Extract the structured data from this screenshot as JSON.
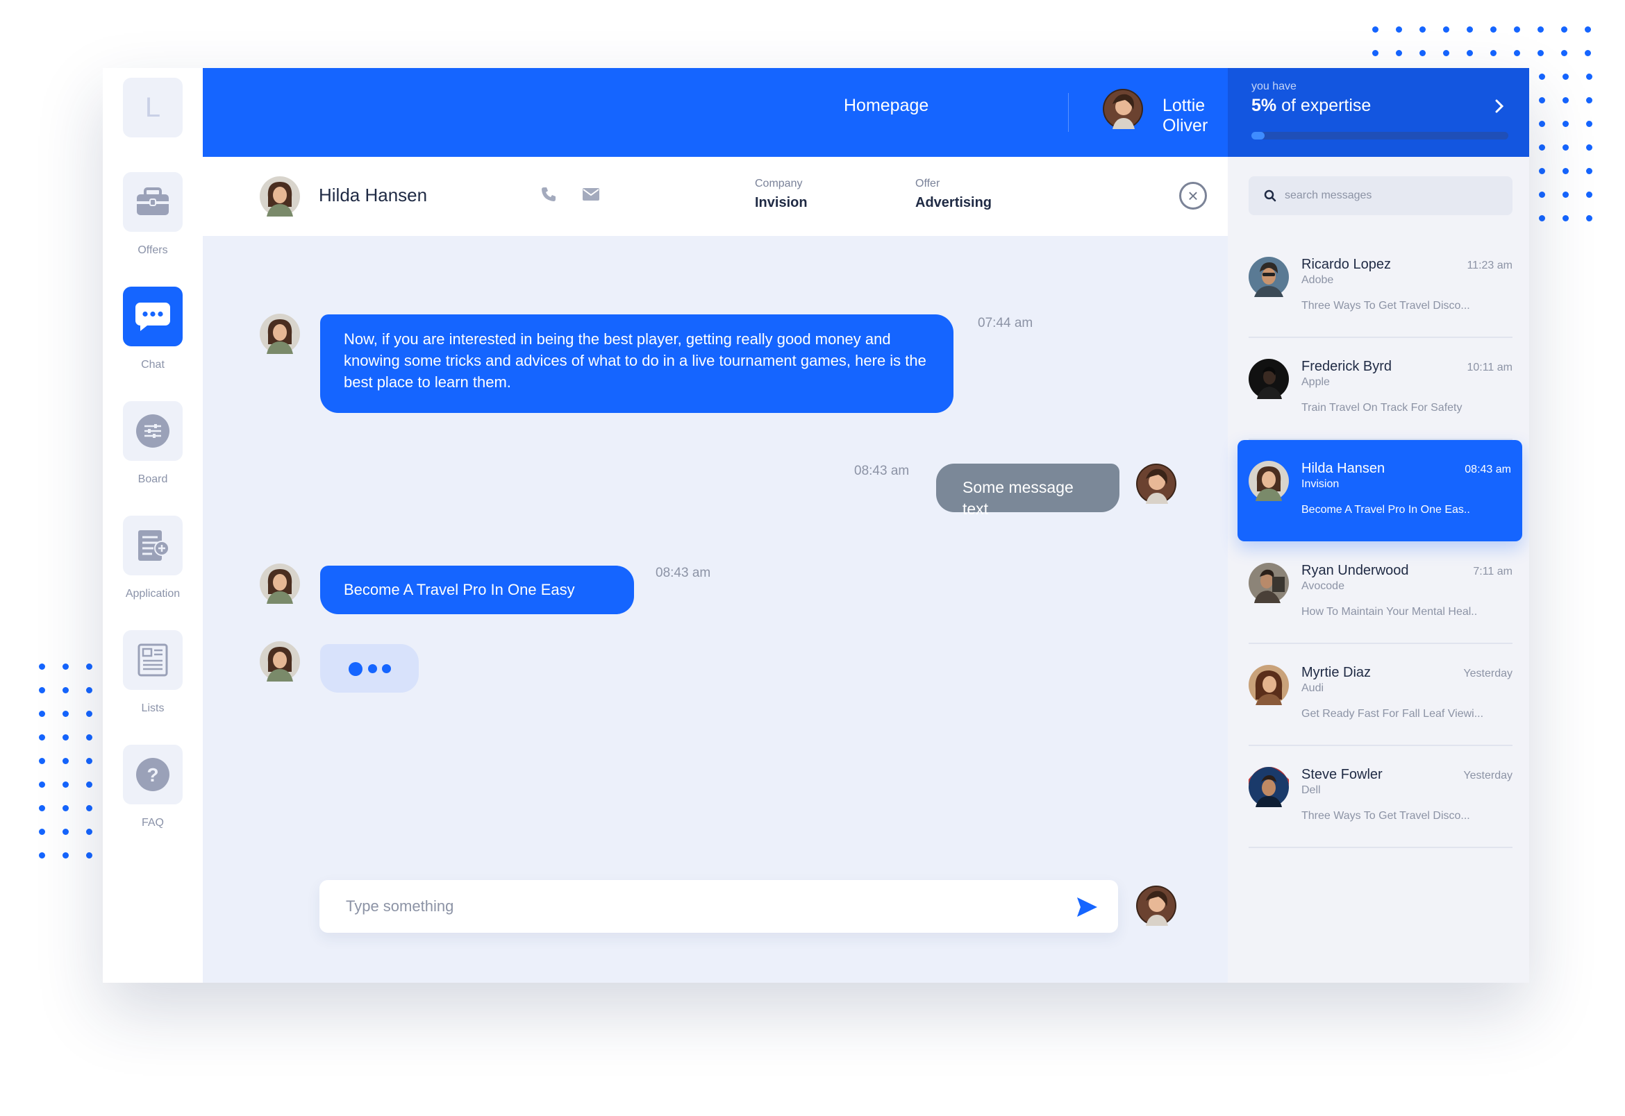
{
  "app": {
    "logo_letter": "L"
  },
  "sidebar": {
    "items": [
      {
        "label": "Offers",
        "icon": "briefcase-icon"
      },
      {
        "label": "Chat",
        "icon": "chat-bubble-icon",
        "active": true
      },
      {
        "label": "Board",
        "icon": "sliders-icon"
      },
      {
        "label": "Application",
        "icon": "document-add-icon"
      },
      {
        "label": "Lists",
        "icon": "list-icon"
      },
      {
        "label": "FAQ",
        "icon": "question-icon"
      }
    ]
  },
  "topbar": {
    "homepage_label": "Homepage",
    "user_name": "Lottie Oliver"
  },
  "expertise": {
    "prefix": "you have",
    "value": "5%",
    "suffix": "of expertise",
    "progress_fraction": 0.05
  },
  "chat_header": {
    "contact_name": "Hilda Hansen",
    "company_label": "Company",
    "company_value": "Invision",
    "offer_label": "Offer",
    "offer_value": "Advertising"
  },
  "messages": [
    {
      "from": "contact",
      "text": "Now, if you are interested in being the best player, getting really good money and knowing some tricks and advices of what to do in a live tournament games, here is the best place to learn them.",
      "time": "07:44 am"
    },
    {
      "from": "me",
      "text": "Some message text",
      "time": "08:43 am"
    },
    {
      "from": "contact",
      "text": "Become A Travel Pro In One Easy",
      "time": "08:43 am"
    }
  ],
  "composer": {
    "placeholder": "Type something"
  },
  "search": {
    "placeholder": "search messages"
  },
  "conversations": [
    {
      "name": "Ricardo Lopez",
      "company": "Adobe",
      "time": "11:23 am",
      "snippet": "Three Ways To Get Travel Disco..."
    },
    {
      "name": "Frederick Byrd",
      "company": "Apple",
      "time": "10:11 am",
      "snippet": "Train Travel On Track For Safety"
    },
    {
      "name": "Hilda Hansen",
      "company": "Invision",
      "time": "08:43 am",
      "snippet": "Become A Travel Pro In One Eas..",
      "active": true
    },
    {
      "name": "Ryan Underwood",
      "company": "Avocode",
      "time": "7:11 am",
      "snippet": "How To Maintain Your Mental Heal.."
    },
    {
      "name": "Myrtie Diaz",
      "company": "Audi",
      "time": "Yesterday",
      "snippet": "Get Ready Fast For Fall Leaf Viewi..."
    },
    {
      "name": "Steve Fowler",
      "company": "Dell",
      "time": "Yesterday",
      "snippet": "Three Ways To Get Travel Disco..."
    }
  ],
  "colors": {
    "accent": "#1565ff",
    "accent_dark": "#1356e0",
    "background": "#ecf0fa"
  }
}
